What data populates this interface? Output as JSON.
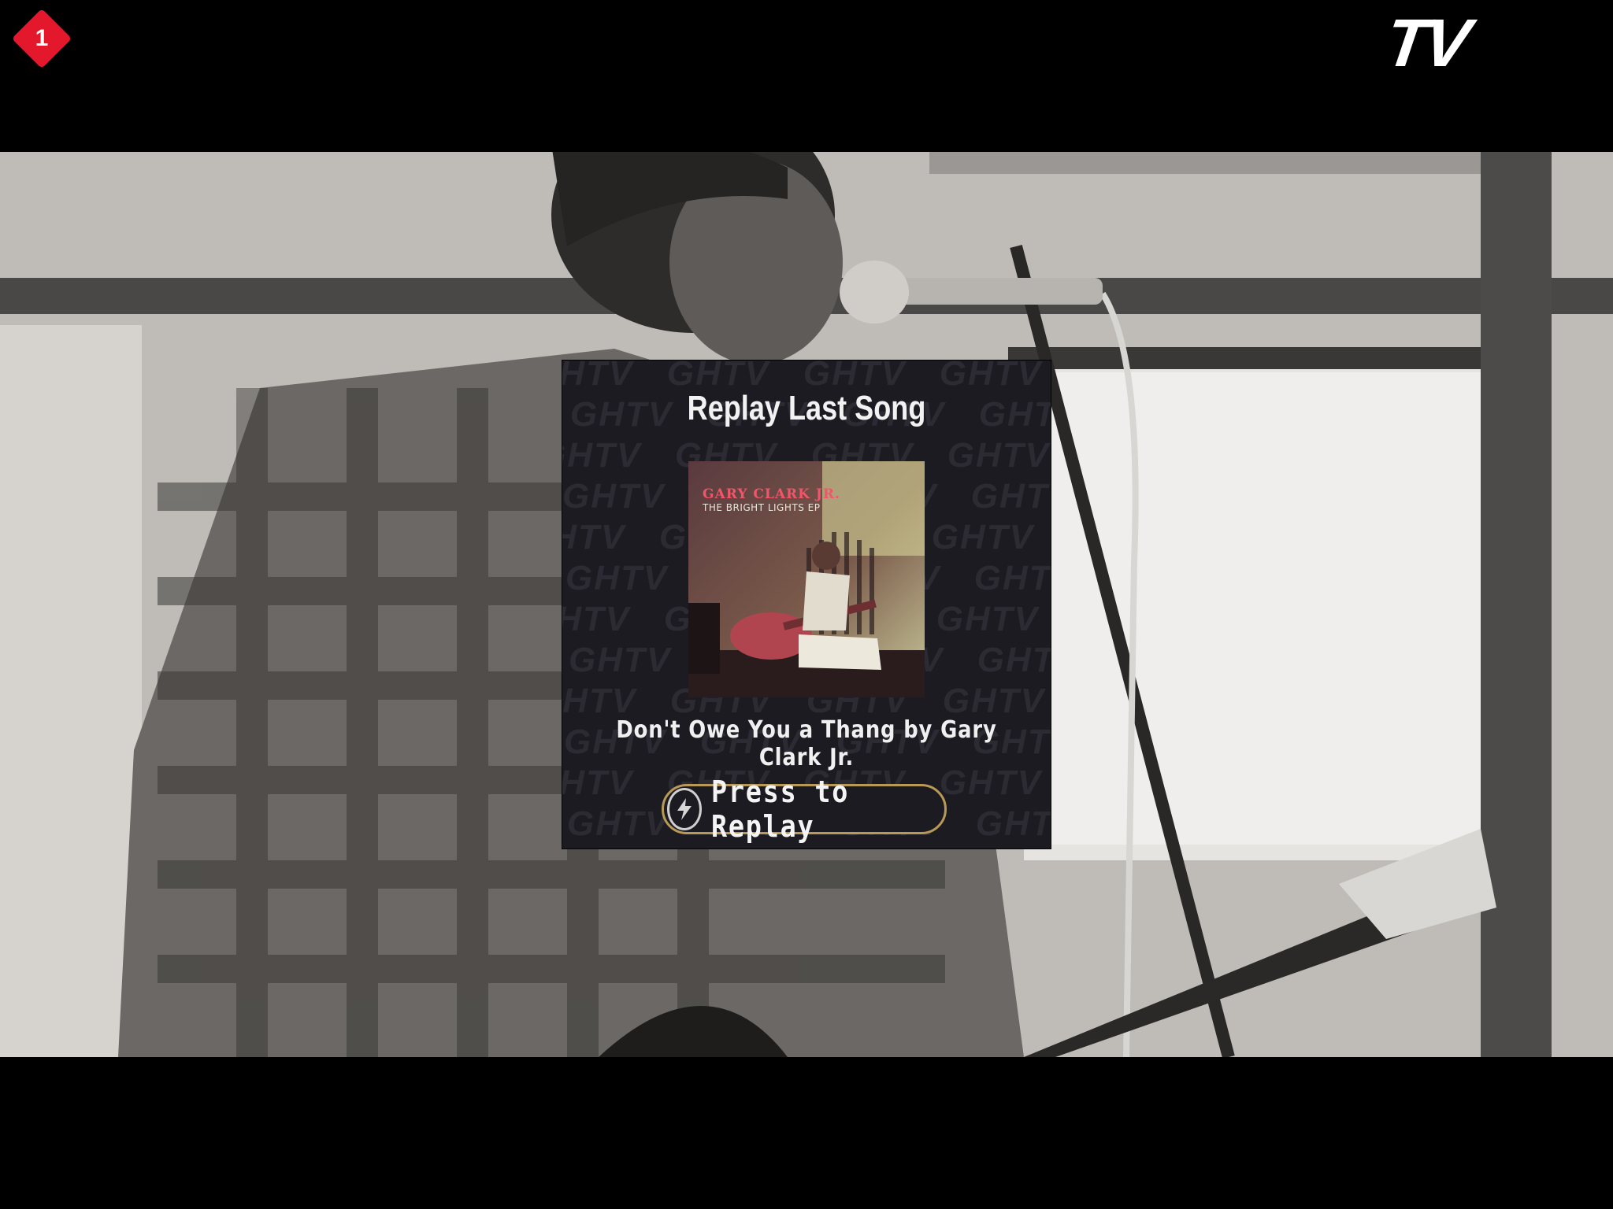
{
  "hud": {
    "player_number": "1",
    "logo_text": "TV"
  },
  "modal": {
    "title": "Replay Last Song",
    "watermark_text": "GHTV",
    "album": {
      "artist": "GARY CLARK JR.",
      "release": "THE BRIGHT LIGHTS EP"
    },
    "song_line": "Don't Owe You a Thang by Gary Clark Jr.",
    "button_label": "Press to Replay",
    "button_icon": "lightning-bolt-icon"
  },
  "colors": {
    "badge_red": "#e3182d",
    "button_border_gold": "#b89a56",
    "modal_bg": "#1c1b22"
  }
}
